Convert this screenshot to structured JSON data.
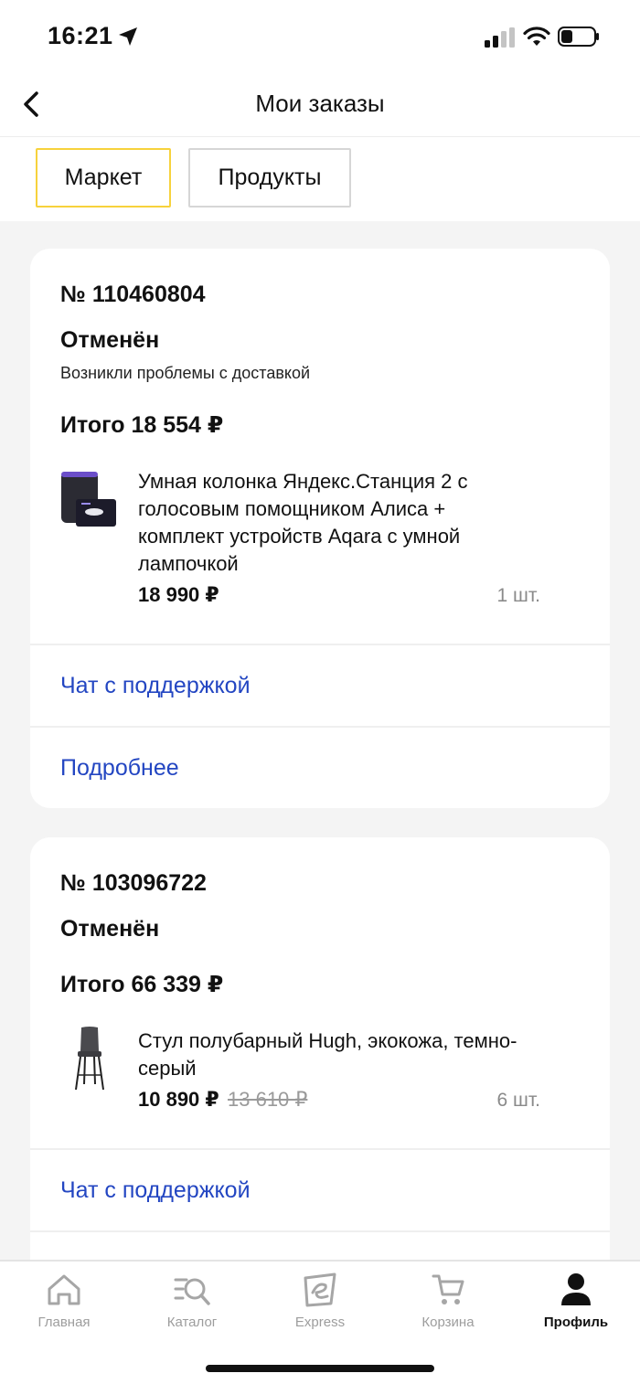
{
  "status_bar": {
    "time": "16:21"
  },
  "header": {
    "title": "Мои заказы"
  },
  "tabs": [
    {
      "label": "Маркет",
      "active": true
    },
    {
      "label": "Продукты",
      "active": false
    }
  ],
  "orders": [
    {
      "number": "№ 110460804",
      "status": "Отменён",
      "reason": "Возникли проблемы с доставкой",
      "total": "Итого 18 554 ₽",
      "item": {
        "name": "Умная колонка Яндекс.Станция 2 с голосовым помощником Алиса + комплект устройств Aqara с умной лампочкой",
        "price": "18 990 ₽",
        "quantity": "1 шт."
      },
      "links": [
        "Чат с поддержкой",
        "Подробнее"
      ]
    },
    {
      "number": "№ 103096722",
      "status": "Отменён",
      "total": "Итого 66 339 ₽",
      "item": {
        "name": "Стул полубарный Hugh, экокожа, темно-серый",
        "price": "10 890 ₽",
        "old_price": "13 610 ₽",
        "quantity": "6 шт."
      },
      "links": [
        "Чат с поддержкой"
      ]
    }
  ],
  "bottom_nav": [
    {
      "label": "Главная",
      "icon": "home-icon",
      "active": false
    },
    {
      "label": "Каталог",
      "icon": "catalog-search-icon",
      "active": false
    },
    {
      "label": "Express",
      "icon": "express-icon",
      "active": false
    },
    {
      "label": "Корзина",
      "icon": "cart-icon",
      "active": false
    },
    {
      "label": "Профиль",
      "icon": "profile-icon",
      "active": true
    }
  ],
  "colors": {
    "link": "#2346c2",
    "active_tab_border": "#f7d23c",
    "background": "#f4f4f4"
  }
}
